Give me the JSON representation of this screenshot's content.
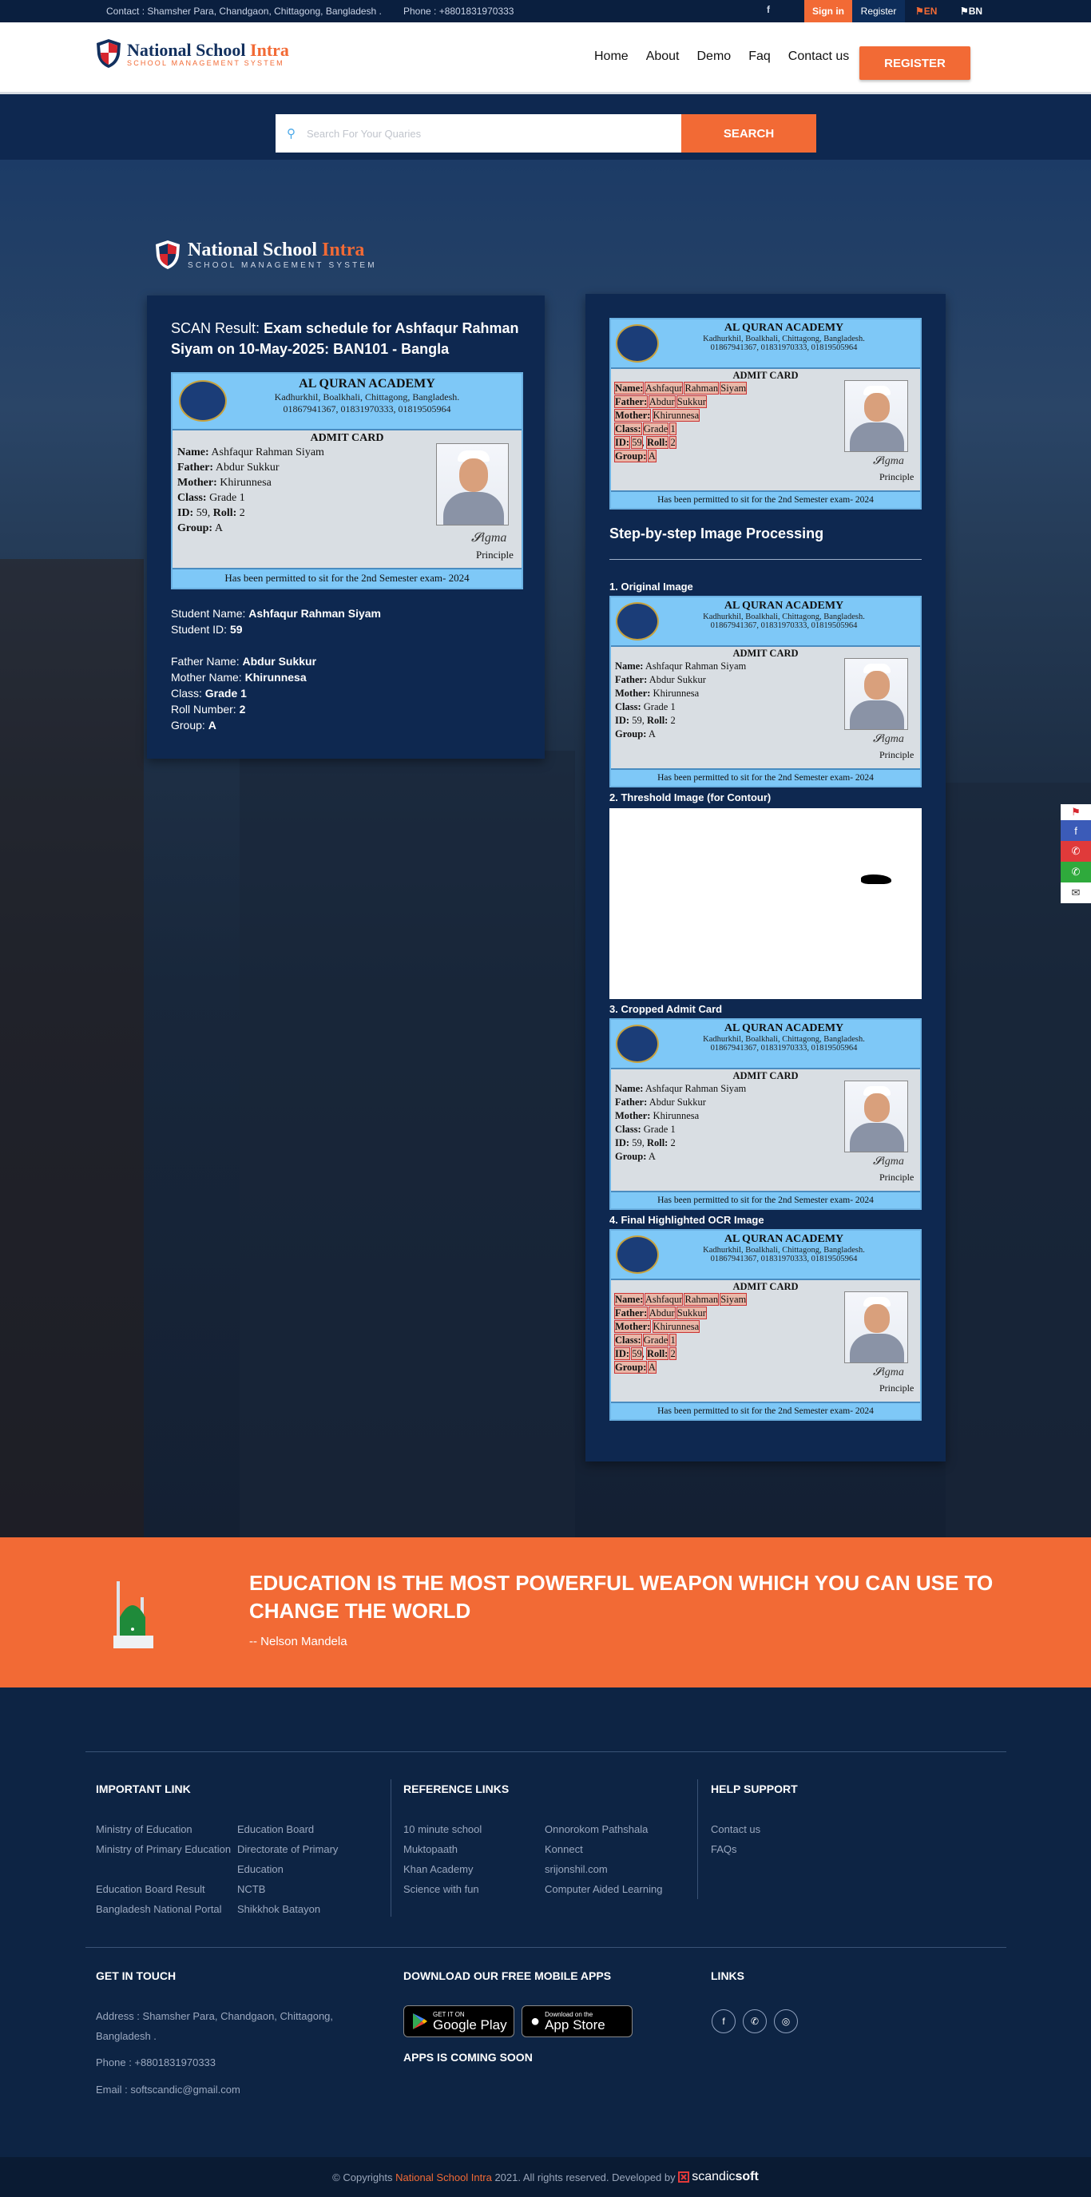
{
  "topbar": {
    "contact": "Contact : Shamsher Para, Chandgaon, Chittagong, Bangladesh .",
    "phone": "Phone : +8801831970333",
    "facebook_icon": "f",
    "signin": "Sign in",
    "register": "Register",
    "lang_en": "EN",
    "lang_bn": "BN",
    "accent": "#f26a35"
  },
  "header": {
    "logo_title_1": "National School",
    "logo_title_2": "Intra",
    "logo_sub": "SCHOOL MANAGEMENT SYSTEM",
    "nav": [
      "Home",
      "About",
      "Demo",
      "Faq",
      "Contact us"
    ],
    "register_button": "REGISTER"
  },
  "search": {
    "placeholder": "Search For Your Quaries",
    "button": "SEARCH"
  },
  "hero_logo": {
    "title_1": "National School",
    "title_2": "Intra",
    "sub": "SCHOOL MANAGEMENT SYSTEM"
  },
  "scan": {
    "prefix": "SCAN Result:",
    "title": "Exam schedule for Ashfaqur Rahman Siyam on 10-May-2025: BAN101 - Bangla",
    "student_name_label": "Student Name:",
    "student_name": "Ashfaqur Rahman Siyam",
    "student_id_label": "Student ID:",
    "student_id": "59",
    "father_label": "Father Name:",
    "father": "Abdur Sukkur",
    "mother_label": "Mother Name:",
    "mother": "Khirunnesa",
    "class_label": "Class:",
    "class": "Grade 1",
    "roll_label": "Roll Number:",
    "roll": "2",
    "group_label": "Group:",
    "group": "A"
  },
  "card": {
    "school": "AL QURAN ACADEMY",
    "address": "Kadhurkhil, Boalkhali, Chittagong, Bangladesh.",
    "phones": "01867941367, 01831970333, 01819505964",
    "title": "ADMIT CARD",
    "name_label": "Name:",
    "name": "Ashfaqur Rahman Siyam",
    "name_parts": [
      "Ashfaqur",
      "Rahman",
      "Siyam"
    ],
    "father_label": "Father:",
    "father": "Abdur Sukkur",
    "father_parts": [
      "Abdur",
      "Sukkur"
    ],
    "mother_label": "Mother:",
    "mother": "Khirunnesa",
    "class_label": "Class:",
    "class": "Grade 1",
    "class_parts": [
      "Grade",
      "1"
    ],
    "id_label": "ID:",
    "id": "59",
    "roll_label": "Roll:",
    "roll": "2",
    "group_label": "Group:",
    "group": "A",
    "signature_label": "Principle",
    "footer": "Has been permitted to sit for the 2nd Semester exam- 2024"
  },
  "processing": {
    "heading": "Step-by-step Image Processing",
    "step1": "1. Original Image",
    "step2": "2. Threshold Image (for Contour)",
    "step3": "3. Cropped Admit Card",
    "step4": "4. Final Highlighted OCR Image"
  },
  "social_float": [
    "flag-icon",
    "facebook-icon",
    "viber-icon",
    "whatsapp-icon",
    "mail-icon"
  ],
  "quote": {
    "text": "EDUCATION IS THE MOST POWERFUL WEAPON WHICH YOU CAN USE TO CHANGE THE WORLD",
    "author": "-- Nelson Mandela"
  },
  "footer": {
    "important_heading": "IMPORTANT LINK",
    "important_col1": [
      "Ministry of Education",
      "Ministry of Primary Education",
      "Education Board Result",
      "Bangladesh National Portal"
    ],
    "important_col2": [
      "Education Board",
      "Directorate of Primary",
      "Education",
      "NCTB",
      "Shikkhok Batayon"
    ],
    "reference_heading": "REFERENCE LINKS",
    "reference_col1": [
      "10 minute school",
      "Muktopaath",
      "Khan Academy",
      "Science with fun"
    ],
    "reference_col2": [
      "Onnorokom Pathshala",
      "Konnect",
      "srijonshil.com",
      "Computer Aided Learning"
    ],
    "help_heading": "HELP SUPPORT",
    "help_links": [
      "Contact us",
      "FAQs"
    ],
    "touch_heading": "GET IN TOUCH",
    "address_1": "Address : Shamsher Para, Chandgaon, Chittagong,",
    "address_2": "Bangladesh .",
    "phone": "Phone : +8801831970333",
    "email": "Email : softscandic@gmail.com",
    "apps_heading": "DOWNLOAD OUR FREE MOBILE APPS",
    "google_small": "GET IT ON",
    "google_big": "Google Play",
    "apple_small": "Download on the",
    "apple_big": "App Store",
    "apps_soon": "APPS IS COMING SOON",
    "links_heading": "LINKS"
  },
  "copyright": {
    "prefix": "© Copyrights",
    "brand": "National School Intra",
    "middle": "2021. All rights reserved. Developed by",
    "dev_1": "scandic",
    "dev_2": "soft"
  }
}
